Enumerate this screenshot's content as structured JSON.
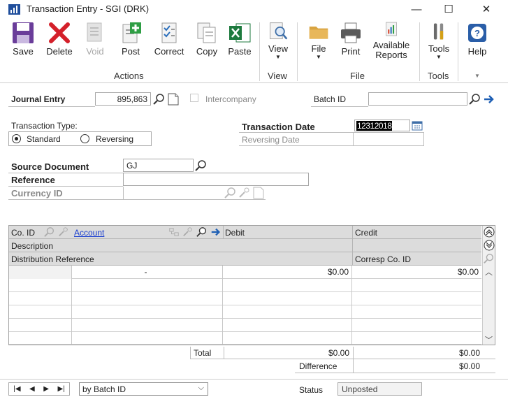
{
  "window": {
    "title": "Transaction Entry  -  SGI (DRK)",
    "minimize": "—",
    "maximize": "☐",
    "close": "✕"
  },
  "ribbon": {
    "buttons": [
      {
        "label": "Save",
        "icon": "save-icon",
        "enabled": true
      },
      {
        "label": "Delete",
        "icon": "delete-icon",
        "enabled": true
      },
      {
        "label": "Void",
        "icon": "void-icon",
        "enabled": false
      },
      {
        "label": "Post",
        "icon": "post-icon",
        "enabled": true
      },
      {
        "label": "Correct",
        "icon": "correct-icon",
        "enabled": true
      },
      {
        "label": "Copy",
        "icon": "copy-icon",
        "enabled": true
      },
      {
        "label": "Paste",
        "icon": "paste-icon",
        "enabled": true
      },
      {
        "label": "View",
        "icon": "view-icon",
        "enabled": true
      },
      {
        "label": "File",
        "icon": "file-icon",
        "enabled": true
      },
      {
        "label": "Print",
        "icon": "print-icon",
        "enabled": true
      },
      {
        "label": "Available Reports",
        "icon": "reports-icon",
        "enabled": true
      },
      {
        "label": "Tools",
        "icon": "tools-icon",
        "enabled": true
      },
      {
        "label": "Help",
        "icon": "help-icon",
        "enabled": true
      }
    ],
    "groups": {
      "actions": "Actions",
      "view": "View",
      "file": "File",
      "tools": "Tools"
    }
  },
  "form": {
    "journal_entry_label": "Journal Entry",
    "journal_entry_value": "895,863",
    "intercompany_label": "Intercompany",
    "batch_id_label": "Batch ID",
    "batch_id_value": "",
    "transaction_type_label": "Transaction Type:",
    "standard_label": "Standard",
    "reversing_label": "Reversing",
    "transaction_date_label": "Transaction Date",
    "transaction_date_value": "12312018",
    "reversing_date_label": "Reversing Date",
    "source_document_label": "Source Document",
    "source_document_value": "GJ",
    "reference_label": "Reference",
    "reference_value": "",
    "currency_id_label": "Currency ID",
    "currency_id_value": ""
  },
  "grid": {
    "headers": {
      "co_id": "Co. ID",
      "account": "Account",
      "debit": "Debit",
      "credit": "Credit",
      "description": "Description",
      "distribution_reference": "Distribution Reference",
      "corresp_co_id": "Corresp Co. ID"
    },
    "rows": [
      {
        "co_id": "",
        "account": "-",
        "debit": "$0.00",
        "credit": "$0.00"
      },
      {
        "co_id": "",
        "account": "",
        "debit": "",
        "credit": ""
      },
      {
        "co_id": "",
        "account": "",
        "debit": "",
        "credit": ""
      },
      {
        "co_id": "",
        "account": "",
        "debit": "",
        "credit": ""
      },
      {
        "co_id": "",
        "account": "",
        "debit": "",
        "credit": ""
      },
      {
        "co_id": "",
        "account": "",
        "debit": "",
        "credit": ""
      }
    ]
  },
  "totals": {
    "total_label": "Total",
    "total_debit": "$0.00",
    "total_credit": "$0.00",
    "difference_label": "Difference",
    "difference_value": "$0.00"
  },
  "footer": {
    "sort_value": "by Batch ID",
    "status_label": "Status",
    "status_value": "Unposted"
  }
}
